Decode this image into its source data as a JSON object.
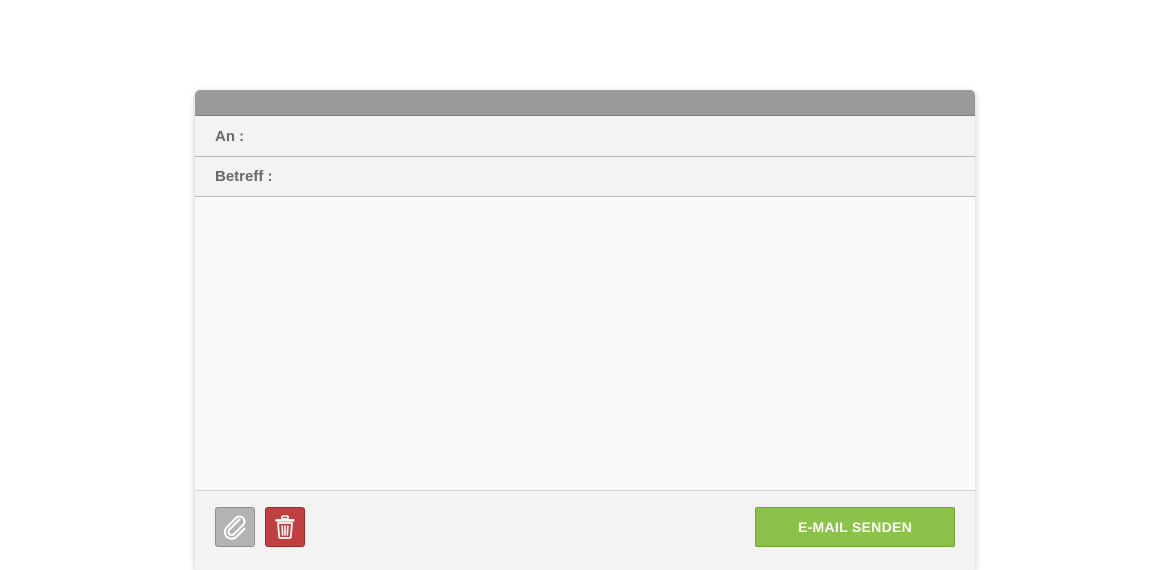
{
  "composer": {
    "to_label": "An :",
    "to_value": "",
    "subject_label": "Betreff :",
    "subject_value": "",
    "body_value": ""
  },
  "toolbar": {
    "attach_icon": "paperclip-icon",
    "delete_icon": "trash-icon",
    "send_label": "E-MAIL SENDEN"
  },
  "colors": {
    "titlebar": "#9a9a9a",
    "attach_button": "#b3b3b3",
    "delete_button": "#c13f3f",
    "send_button": "#8bc34a"
  }
}
